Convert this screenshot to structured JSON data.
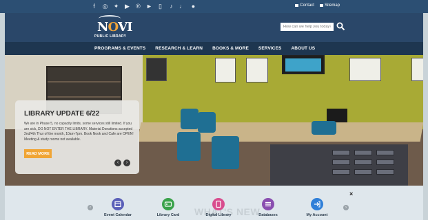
{
  "topbar": {
    "social_icons": [
      "facebook-icon",
      "instagram-icon",
      "twitter-icon",
      "youtube-icon",
      "pinterest-icon",
      "play-icon",
      "mobile-icon",
      "podcast-icon",
      "tiktok-icon",
      "spotify-icon"
    ],
    "contact_label": "Contact",
    "sitemap_label": "Sitemap"
  },
  "header": {
    "logo_main_left": "N",
    "logo_main_accent": "O",
    "logo_main_right": "VI",
    "logo_sub": "PUBLIC LIBRARY",
    "search_placeholder": "How can we help you today?"
  },
  "nav": {
    "items": [
      "PROGRAMS & EVENTS",
      "RESEARCH & LEARN",
      "BOOKS & MORE",
      "SERVICES",
      "ABOUT US"
    ]
  },
  "hero": {
    "card_title": "LIBRARY UPDATE 6/22",
    "card_body": "We are in Phase 5, no capacity limits, some services still limited. If you are sick, DO NOT ENTER THE LIBRARY. Material Donations accepted 2nd/4th Thur of the month, 10am-7pm. Book Nook and Cafe are OPEN! Meeting & study rooms not available.",
    "read_more": "READ MORE",
    "prev_arrow": "‹",
    "next_arrow": "›"
  },
  "bottom": {
    "heading": "WHAT'S NEW",
    "close": "×",
    "prev": "‹",
    "next": "›",
    "items": [
      {
        "label": "Event Calendar",
        "color": "#5a5fb8",
        "icon": "calendar-icon"
      },
      {
        "label": "Library Card",
        "color": "#3aa24a",
        "icon": "library-card-icon"
      },
      {
        "label": "Digital Library",
        "color": "#d84d8e",
        "icon": "tablet-icon"
      },
      {
        "label": "Databases",
        "color": "#8a4fb0",
        "icon": "database-icon"
      },
      {
        "label": "My Account",
        "color": "#2f7fd8",
        "icon": "login-icon"
      }
    ]
  }
}
